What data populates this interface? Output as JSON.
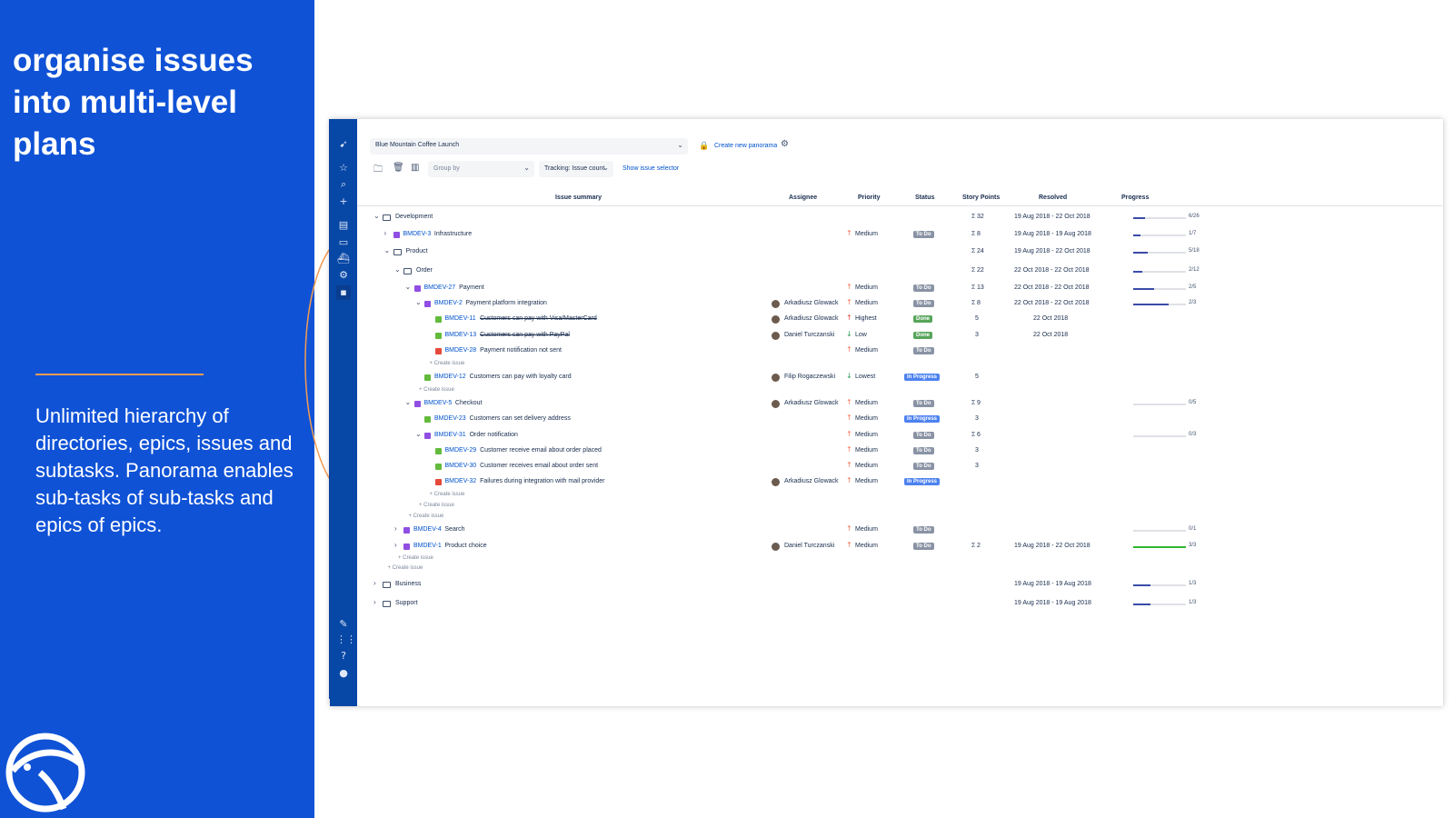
{
  "slide": {
    "headline": "organise issues into multi-level plans",
    "description": "Unlimited hierarchy of directories, epics, issues and subtasks. Panorama enables sub-tasks of sub-tasks and epics of epics.",
    "colors": {
      "panel": "#0f52d6",
      "accent": "#f29b52",
      "nav": "#0747a6"
    }
  },
  "app": {
    "panorama_name": "Blue Mountain Coffee Launch",
    "create_panorama_label": "Create new panorama",
    "group_by_placeholder": "Group by",
    "tracking_label": "Tracking: Issue count",
    "show_selector_label": "Show issue selector",
    "columns": [
      "Issue summary",
      "Assignee",
      "Priority",
      "Status",
      "Story Points",
      "Resolved",
      "Progress"
    ],
    "rows": [
      {
        "kind": "folder",
        "level": 0,
        "toggle": "open",
        "summary": "Development",
        "sp": "32",
        "sigma": true,
        "resolved": "19 Aug 2018 - 22 Oct 2018",
        "progress": 6,
        "total": 26,
        "ptext": "6/26"
      },
      {
        "kind": "issue",
        "type": "epic",
        "level": 1,
        "toggle": "closed",
        "key": "BMDEV-3",
        "summary": "Infrastructure",
        "priority": "Medium",
        "prio": "up",
        "status": "To Do",
        "st": "todo",
        "sp": "8",
        "sigma": true,
        "resolved": "19 Aug 2018 - 19 Aug 2018",
        "progress": 1,
        "total": 7,
        "ptext": "1/7"
      },
      {
        "kind": "folder",
        "level": 1,
        "toggle": "open",
        "summary": "Product",
        "sp": "24",
        "sigma": true,
        "resolved": "19 Aug 2018 - 22 Oct 2018",
        "progress": 5,
        "total": 18,
        "ptext": "5/18"
      },
      {
        "kind": "folder",
        "level": 2,
        "toggle": "open",
        "summary": "Order",
        "sp": "22",
        "sigma": true,
        "resolved": "22 Oct 2018 - 22 Oct 2018",
        "progress": 2,
        "total": 12,
        "ptext": "2/12"
      },
      {
        "kind": "issue",
        "type": "epic",
        "level": 3,
        "toggle": "open",
        "key": "BMDEV-27",
        "summary": "Payment",
        "priority": "Medium",
        "prio": "up",
        "status": "To Do",
        "st": "todo",
        "sp": "13",
        "sigma": true,
        "resolved": "22 Oct 2018 - 22 Oct 2018",
        "progress": 2,
        "total": 5,
        "ptext": "2/5"
      },
      {
        "kind": "issue",
        "type": "epic",
        "level": 4,
        "toggle": "open",
        "key": "BMDEV-2",
        "summary": "Payment platform integration",
        "assignee": "Arkadiusz Glowack",
        "priority": "Medium",
        "prio": "up",
        "status": "To Do",
        "st": "todo",
        "sp": "8",
        "sigma": true,
        "resolved": "22 Oct 2018 - 22 Oct 2018",
        "progress": 2,
        "total": 3,
        "ptext": "2/3"
      },
      {
        "kind": "issue",
        "type": "story",
        "level": 5,
        "key": "BMDEV-11",
        "summary": "Customers can pay with Visa/MasterCard",
        "done": true,
        "assignee": "Arkadiusz Glowack",
        "priority": "Highest",
        "prio": "high",
        "status": "Done",
        "st": "done",
        "sp": "5",
        "resolved": "22 Oct 2018"
      },
      {
        "kind": "issue",
        "type": "story",
        "level": 5,
        "key": "BMDEV-13",
        "summary": "Customers can pay with PayPal",
        "done": true,
        "assignee": "Daniel Turczanski",
        "priority": "Low",
        "prio": "down",
        "status": "Done",
        "st": "done",
        "sp": "3",
        "resolved": "22 Oct 2018"
      },
      {
        "kind": "issue",
        "type": "bug",
        "level": 5,
        "key": "BMDEV-28",
        "summary": "Payment notification not sent",
        "priority": "Medium",
        "prio": "up",
        "status": "To Do",
        "st": "todo"
      },
      {
        "kind": "create",
        "level": 5,
        "label": "+ Create issue"
      },
      {
        "kind": "issue",
        "type": "story",
        "level": 4,
        "key": "BMDEV-12",
        "summary": "Customers can pay with loyalty card",
        "assignee": "Filip Rogaczewski",
        "priority": "Lowest",
        "prio": "down",
        "status": "In Progress",
        "st": "prog",
        "sp": "5"
      },
      {
        "kind": "create",
        "level": 4,
        "label": "+ Create issue"
      },
      {
        "kind": "issue",
        "type": "epic",
        "level": 3,
        "toggle": "open",
        "key": "BMDEV-5",
        "summary": "Checkout",
        "assignee": "Arkadiusz Glowack",
        "priority": "Medium",
        "prio": "up",
        "status": "To Do",
        "st": "todo",
        "sp": "9",
        "sigma": true,
        "progress": 0,
        "total": 5,
        "ptext": "0/5"
      },
      {
        "kind": "issue",
        "type": "story",
        "level": 4,
        "key": "BMDEV-23",
        "summary": "Customers can set delivery address",
        "priority": "Medium",
        "prio": "up",
        "status": "In Progress",
        "st": "prog",
        "sp": "3"
      },
      {
        "kind": "issue",
        "type": "epic",
        "level": 4,
        "toggle": "open",
        "key": "BMDEV-31",
        "summary": "Order notification",
        "priority": "Medium",
        "prio": "up",
        "status": "To Do",
        "st": "todo",
        "sp": "6",
        "sigma": true,
        "progress": 0,
        "total": 3,
        "ptext": "0/3"
      },
      {
        "kind": "issue",
        "type": "story",
        "level": 5,
        "key": "BMDEV-29",
        "summary": "Customer receive email about order placed",
        "priority": "Medium",
        "prio": "up",
        "status": "To Do",
        "st": "todo",
        "sp": "3"
      },
      {
        "kind": "issue",
        "type": "story",
        "level": 5,
        "key": "BMDEV-30",
        "summary": "Customer receives email about order sent",
        "priority": "Medium",
        "prio": "up",
        "status": "To Do",
        "st": "todo",
        "sp": "3"
      },
      {
        "kind": "issue",
        "type": "bug",
        "level": 5,
        "key": "BMDEV-32",
        "summary": "Failures during integration with mail provider",
        "assignee": "Arkadiusz Glowack",
        "priority": "Medium",
        "prio": "up",
        "status": "In Progress",
        "st": "prog"
      },
      {
        "kind": "create",
        "level": 5,
        "label": "+ Create issue"
      },
      {
        "kind": "create",
        "level": 4,
        "label": "+ Create issue"
      },
      {
        "kind": "create",
        "level": 3,
        "label": "+ Create issue"
      },
      {
        "kind": "issue",
        "type": "epic",
        "level": 2,
        "toggle": "closed",
        "key": "BMDEV-4",
        "summary": "Search",
        "priority": "Medium",
        "prio": "up",
        "status": "To Do",
        "st": "todo",
        "progress": 0,
        "total": 1,
        "ptext": "0/1"
      },
      {
        "kind": "issue",
        "type": "epic",
        "level": 2,
        "toggle": "closed",
        "key": "BMDEV-1",
        "summary": "Product choice",
        "assignee": "Daniel Turczanski",
        "priority": "Medium",
        "prio": "up",
        "status": "To Do",
        "st": "todo",
        "sp": "2",
        "sigma": true,
        "resolved": "19 Aug 2018 - 22 Oct 2018",
        "progress": 3,
        "total": 3,
        "ptext": "3/3",
        "green": true
      },
      {
        "kind": "create",
        "level": 2,
        "label": "+ Create issue"
      },
      {
        "kind": "create",
        "level": 1,
        "label": "+ Create issue"
      },
      {
        "kind": "folder",
        "level": 0,
        "toggle": "closed",
        "summary": "Business",
        "resolved": "19 Aug 2018 - 19 Aug 2018",
        "progress": 1,
        "total": 3,
        "ptext": "1/3"
      },
      {
        "kind": "folder",
        "level": 0,
        "toggle": "closed",
        "summary": "Support",
        "resolved": "19 Aug 2018 - 19 Aug 2018",
        "progress": 1,
        "total": 3,
        "ptext": "1/3"
      }
    ]
  }
}
